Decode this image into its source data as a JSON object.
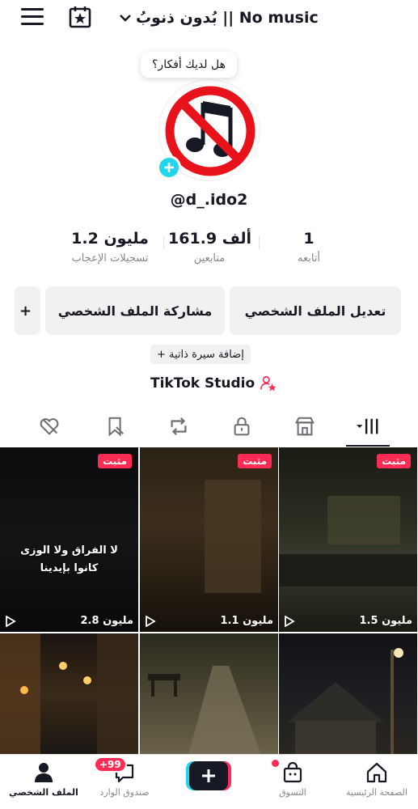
{
  "header": {
    "title": "بُدون ذنوبُ || No music",
    "menu_icon": "hamburger-menu-icon",
    "calendar_icon": "calendar-star-icon",
    "dropdown_icon": "chevron-down-icon"
  },
  "profile": {
    "bubble_text": "هل لديك أفكار؟",
    "username": "@d_.ido2",
    "avatar_icon": "no-music-icon"
  },
  "stats": {
    "following": {
      "value": "1",
      "label": "أتابعه"
    },
    "followers": {
      "value": "161.9 ألف",
      "label": "متابعين"
    },
    "likes": {
      "value": "1.2 مليون",
      "label": "تسجيلات الإعجاب"
    }
  },
  "buttons": {
    "edit_profile": "تعديل الملف الشخصي",
    "share_profile": "مشاركة الملف الشخصي",
    "more": "+"
  },
  "bio": {
    "add_bio": "+ إضافة سيرة ذاتية"
  },
  "studio": {
    "label": "TikTok Studio"
  },
  "tabs": [
    {
      "name": "videos",
      "icon": "grid-icon"
    },
    {
      "name": "shop",
      "icon": "storefront-icon"
    },
    {
      "name": "private",
      "icon": "lock-icon"
    },
    {
      "name": "reposts",
      "icon": "repost-icon"
    },
    {
      "name": "favorites",
      "icon": "bookmark-icon"
    },
    {
      "name": "liked",
      "icon": "heart-hidden-icon"
    }
  ],
  "videos": [
    {
      "pinned": "مثبت",
      "views": "1.5 مليون"
    },
    {
      "pinned": "مثبت",
      "views": "1.1 مليون"
    },
    {
      "pinned": "مثبت",
      "views": "2.8 مليون",
      "overlay_line1": "لا الفراق ولا الوزى",
      "overlay_line2": "كانوا بإيدينا"
    },
    {
      "views": ""
    },
    {
      "views": ""
    },
    {
      "views": ""
    }
  ],
  "bottom_nav": {
    "home": "الصفحة الرئيسية",
    "shop": "التسوق",
    "create_icon": "plus-icon",
    "inbox": "صندوق الوارد",
    "inbox_badge": "+99",
    "profile": "الملف الشخصي"
  },
  "colors": {
    "accent": "#fe2c55",
    "cyan": "#20d5ec",
    "text": "#161823",
    "muted": "#86878b"
  }
}
